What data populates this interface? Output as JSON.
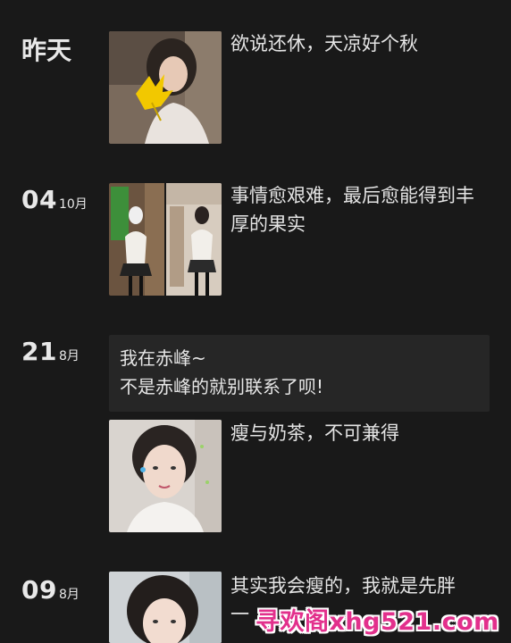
{
  "posts": [
    {
      "date_word": "昨天",
      "caption": "欲说还休，天凉好个秋"
    },
    {
      "day": "04",
      "month": "10月",
      "caption": "事情愈艰难，最后愈能得到丰厚的果实"
    },
    {
      "day": "21",
      "month": "8月",
      "text_lines": [
        "我在赤峰~",
        "不是赤峰的就别联系了呗!"
      ],
      "caption": "瘦与奶茶，不可兼得"
    },
    {
      "day": "09",
      "month": "8月",
      "caption": "其实我会瘦的，我就是先胖一"
    }
  ],
  "watermark": "寻欢阁xhg521.com",
  "colors": {
    "background": "#191919",
    "text_card": "#262626",
    "watermark": "#e2308c"
  }
}
